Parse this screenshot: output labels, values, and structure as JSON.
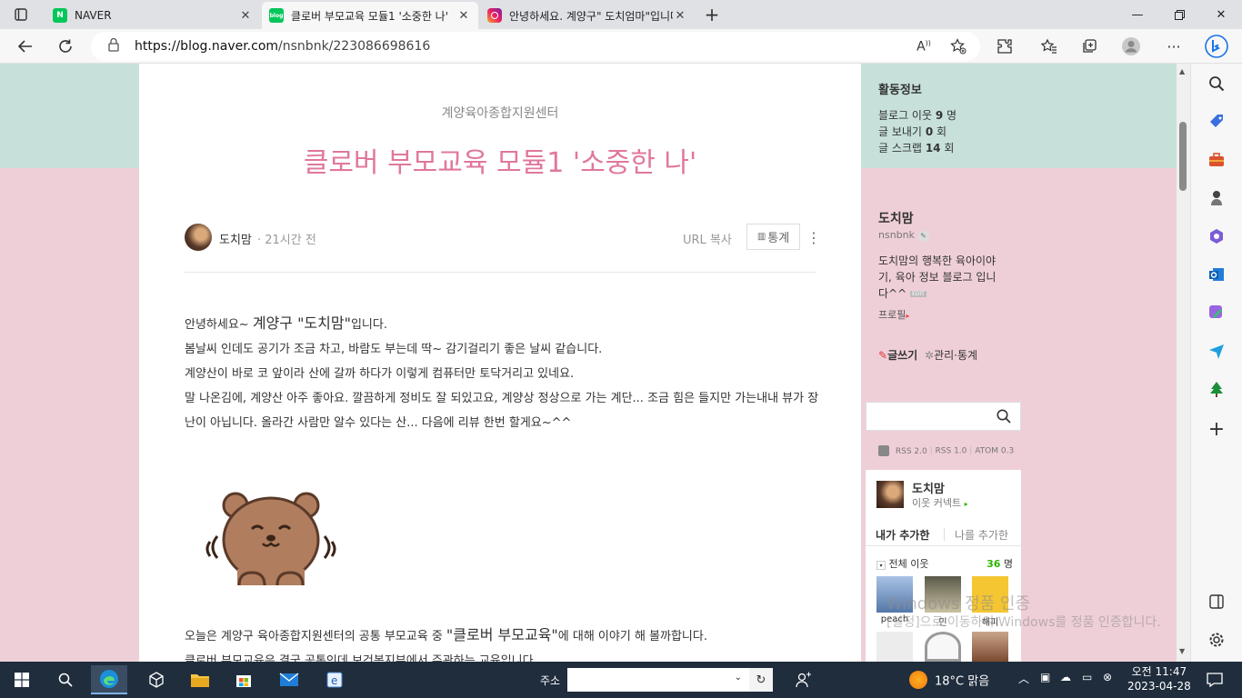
{
  "browser": {
    "tabs": [
      {
        "label": "NAVER",
        "favicon": "N"
      },
      {
        "label": "클로버 부모교육 모듈1 '소중한 나'",
        "favicon": "blog"
      },
      {
        "label": "안녕하세요. 계양구\" 도치엄마\"입니다",
        "favicon": "ig"
      }
    ],
    "url_host": "https://blog.naver.com",
    "url_path": "/nsnbnk/223086698616"
  },
  "post": {
    "category": "계양육아종합지원센터",
    "title": "클로버 부모교육 모듈1 '소중한 나'",
    "author": "도치맘",
    "time": "· 21시간 전",
    "url_copy": "URL 복사",
    "stats_button": "통계",
    "greeting_prefix": "안녕하세요~ ",
    "greeting_big": "계양구 \"도치맘\"",
    "greeting_suffix": "입니다.",
    "lines": [
      "봄날씨 인데도 공기가 조금 차고, 바람도 부는데 딱~ 감기걸리기 좋은 날씨 같습니다.",
      "계양산이 바로 코 앞이라 산에 갈까 하다가 이렇게 컴퓨터만 토닥거리고 있네요.",
      "말 나온김에, 계양산 아주 좋아요. 깔끔하게 정비도 잘 되있고요, 계양상 정상으로 가는 계단... 조금 힘은 들지만 가는내내 뷰가 장난이 아닙니다. 올라간 사람만 알수 있다는 산... 다음에 리뷰 한번 할게요~^^"
    ],
    "para2_prefix": "오늘은 계양구 육아종합지원센터의 공통 부모교육 중 ",
    "para2_big": "\"클로버 부모교육\"",
    "para2_suffix": "에 대해 이야기 해 볼까합니다.",
    "para2_cut": "클로버 부모교육은 결국 공통인데 보건복지부에서 주관하는 교육입니다."
  },
  "sidebar": {
    "activity_title": "활동정보",
    "neighbors_label": "블로그 이웃",
    "neighbors_count": "9",
    "neighbors_unit": "명",
    "sends_label": "글 보내기",
    "sends_count": "0",
    "sends_unit": "회",
    "scraps_label": "글 스크랩",
    "scraps_count": "14",
    "scraps_unit": "회",
    "nickname": "도치맘",
    "blog_id": "nsnbnk",
    "intro_line1": "도치맘의 행복한 육아이야",
    "intro_line2": "기, 육아 정보 블로그 입니",
    "intro_line3": "다^^",
    "edit_badge": "EDIT",
    "profile_link": "프로필",
    "write_link": "글쓰기",
    "manage_link": "관리·통계",
    "rss": [
      "RSS 2.0",
      "RSS 1.0",
      "ATOM 0.3"
    ],
    "neighbor_box": {
      "name": "도치맘",
      "connect": "이웃 커넥트",
      "tab_mine": "내가 추가한",
      "tab_others": "나를 추가한",
      "all_label": "전체 이웃",
      "all_count": "36",
      "all_unit": "명",
      "names": [
        "peach",
        "민",
        "해피"
      ]
    }
  },
  "watermark": {
    "line1": "Windows 정품 인증",
    "line2": "[설정]으로 이동하여 Windows를 정품 인증합니다."
  },
  "taskbar": {
    "address_label": "주소",
    "weather": "18°C 맑음",
    "time": "오전 11:47",
    "date": "2023-04-28"
  }
}
